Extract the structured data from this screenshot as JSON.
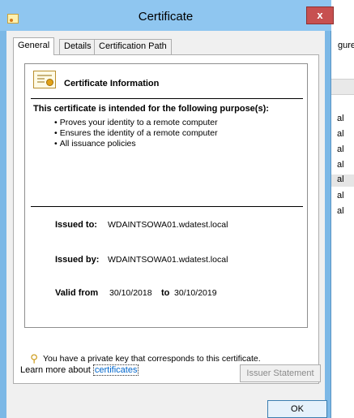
{
  "window": {
    "title": "Certificate",
    "close_glyph": "x"
  },
  "tabs": [
    {
      "label": "General",
      "active": true
    },
    {
      "label": "Details",
      "active": false
    },
    {
      "label": "Certification Path",
      "active": false
    }
  ],
  "info": {
    "heading": "Certificate Information",
    "purpose_heading": "This certificate is intended for the following purpose(s):",
    "purposes": [
      "Proves your identity to a remote computer",
      "Ensures the identity of a remote computer",
      "All issuance policies"
    ],
    "issued_to_label": "Issued to:",
    "issued_to": "WDAINTSOWA01.wdatest.local",
    "issued_by_label": "Issued by:",
    "issued_by": "WDAINTSOWA01.wdatest.local",
    "valid_from_label": "Valid from",
    "valid_from": "30/10/2018",
    "valid_to_label": "to",
    "valid_to": "30/10/2019",
    "private_key_note": "You have a private key that corresponds to this certificate."
  },
  "buttons": {
    "issuer_statement": "Issuer Statement",
    "ok": "OK"
  },
  "learn_more": {
    "prefix": "Learn more about",
    "link": "certificates"
  },
  "background_window": {
    "header_fragment": "gure",
    "rows": [
      "al",
      "al",
      "al",
      "al",
      "al",
      "al",
      "al"
    ],
    "selected_row_index": 4
  },
  "colors": {
    "titlebar": "#8fc6f0",
    "frame": "#7cb8e6",
    "close_button": "#c75050",
    "link": "#0066cc"
  }
}
